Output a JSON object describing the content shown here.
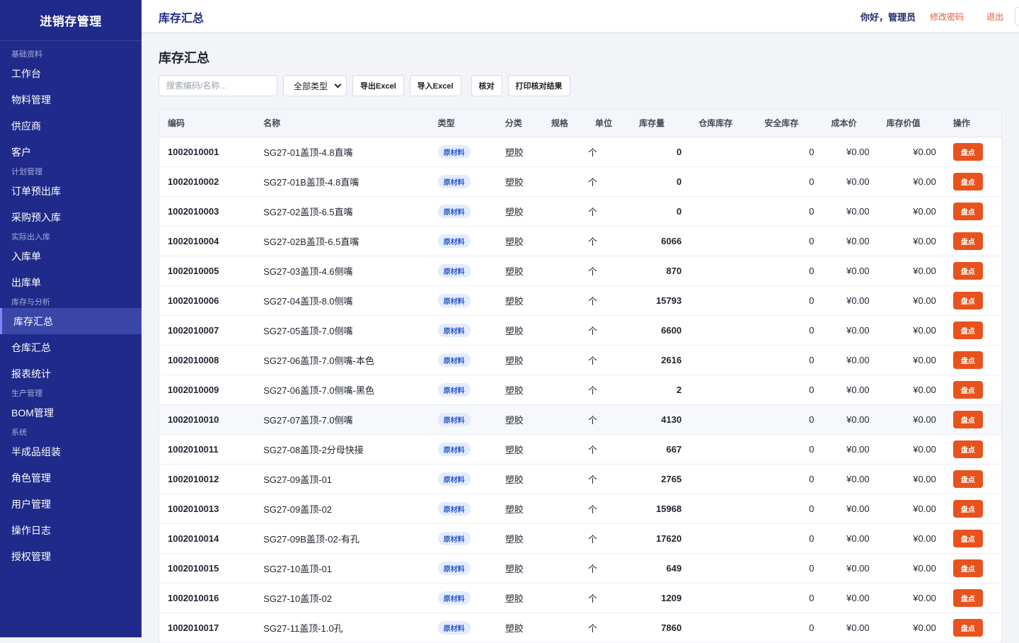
{
  "app": {
    "brand": "进销存管理"
  },
  "sidebar": {
    "groups": [
      {
        "title": "基础资料",
        "items": [
          "工作台",
          "物料管理",
          "供应商",
          "客户"
        ]
      },
      {
        "title": "计划管理",
        "items": [
          "订单预出库",
          "采购预入库"
        ]
      },
      {
        "title": "实际出入库",
        "items": [
          "入库单",
          "出库单"
        ]
      },
      {
        "title": "库存与分析",
        "items": [
          "库存汇总",
          "仓库汇总",
          "报表统计"
        ]
      },
      {
        "title": "生产管理",
        "items": [
          "BOM管理"
        ]
      },
      {
        "title": "系统",
        "items": [
          "半成品组装",
          "角色管理",
          "用户管理",
          "操作日志",
          "授权管理"
        ]
      }
    ],
    "active_item": "库存汇总"
  },
  "topbar": {
    "title": "库存汇总",
    "greeting": "你好，管理员",
    "change_password": "修改密码",
    "logout": "退出"
  },
  "page": {
    "title": "库存汇总"
  },
  "toolbar": {
    "search_placeholder": "搜索编码/名称...",
    "type_select": "全部类型",
    "export_label": "导出Excel",
    "import_label": "导入Excel",
    "check_label": "核对",
    "print_label": "打印核对结果"
  },
  "table": {
    "columns": [
      "编码",
      "名称",
      "类型",
      "分类",
      "规格",
      "单位",
      "库存量",
      "仓库库存",
      "安全库存",
      "成本价",
      "库存价值",
      "操作"
    ],
    "action_label": "盘点",
    "rows": [
      {
        "code": "1002010001",
        "name": "SG27-01盖顶-4.8直嘴",
        "type": "原材料",
        "category": "塑胶",
        "spec": "",
        "unit": "个",
        "qty": "0",
        "wh": "",
        "safe": "0",
        "cost": "¥0.00",
        "value": "¥0.00"
      },
      {
        "code": "1002010002",
        "name": "SG27-01B盖顶-4.8直嘴",
        "type": "原材料",
        "category": "塑胶",
        "spec": "",
        "unit": "个",
        "qty": "0",
        "wh": "",
        "safe": "0",
        "cost": "¥0.00",
        "value": "¥0.00"
      },
      {
        "code": "1002010003",
        "name": "SG27-02盖顶-6.5直嘴",
        "type": "原材料",
        "category": "塑胶",
        "spec": "",
        "unit": "个",
        "qty": "0",
        "wh": "",
        "safe": "0",
        "cost": "¥0.00",
        "value": "¥0.00"
      },
      {
        "code": "1002010004",
        "name": "SG27-02B盖顶-6.5直嘴",
        "type": "原材料",
        "category": "塑胶",
        "spec": "",
        "unit": "个",
        "qty": "6066",
        "wh": "",
        "safe": "0",
        "cost": "¥0.00",
        "value": "¥0.00"
      },
      {
        "code": "1002010005",
        "name": "SG27-03盖顶-4.6侧嘴",
        "type": "原材料",
        "category": "塑胶",
        "spec": "",
        "unit": "个",
        "qty": "870",
        "wh": "",
        "safe": "0",
        "cost": "¥0.00",
        "value": "¥0.00"
      },
      {
        "code": "1002010006",
        "name": "SG27-04盖顶-8.0侧嘴",
        "type": "原材料",
        "category": "塑胶",
        "spec": "",
        "unit": "个",
        "qty": "15793",
        "wh": "",
        "safe": "0",
        "cost": "¥0.00",
        "value": "¥0.00"
      },
      {
        "code": "1002010007",
        "name": "SG27-05盖顶-7.0侧嘴",
        "type": "原材料",
        "category": "塑胶",
        "spec": "",
        "unit": "个",
        "qty": "6600",
        "wh": "",
        "safe": "0",
        "cost": "¥0.00",
        "value": "¥0.00"
      },
      {
        "code": "1002010008",
        "name": "SG27-06盖顶-7.0侧嘴-本色",
        "type": "原材料",
        "category": "塑胶",
        "spec": "",
        "unit": "个",
        "qty": "2616",
        "wh": "",
        "safe": "0",
        "cost": "¥0.00",
        "value": "¥0.00"
      },
      {
        "code": "1002010009",
        "name": "SG27-06盖顶-7.0侧嘴-黑色",
        "type": "原材料",
        "category": "塑胶",
        "spec": "",
        "unit": "个",
        "qty": "2",
        "wh": "",
        "safe": "0",
        "cost": "¥0.00",
        "value": "¥0.00"
      },
      {
        "code": "1002010010",
        "name": "SG27-07盖顶-7.0侧嘴",
        "type": "原材料",
        "category": "塑胶",
        "spec": "",
        "unit": "个",
        "qty": "4130",
        "wh": "",
        "safe": "0",
        "cost": "¥0.00",
        "value": "¥0.00"
      },
      {
        "code": "1002010011",
        "name": "SG27-08盖顶-2分母快接",
        "type": "原材料",
        "category": "塑胶",
        "spec": "",
        "unit": "个",
        "qty": "667",
        "wh": "",
        "safe": "0",
        "cost": "¥0.00",
        "value": "¥0.00"
      },
      {
        "code": "1002010012",
        "name": "SG27-09盖顶-01",
        "type": "原材料",
        "category": "塑胶",
        "spec": "",
        "unit": "个",
        "qty": "2765",
        "wh": "",
        "safe": "0",
        "cost": "¥0.00",
        "value": "¥0.00"
      },
      {
        "code": "1002010013",
        "name": "SG27-09盖顶-02",
        "type": "原材料",
        "category": "塑胶",
        "spec": "",
        "unit": "个",
        "qty": "15968",
        "wh": "",
        "safe": "0",
        "cost": "¥0.00",
        "value": "¥0.00"
      },
      {
        "code": "1002010014",
        "name": "SG27-09B盖顶-02-有孔",
        "type": "原材料",
        "category": "塑胶",
        "spec": "",
        "unit": "个",
        "qty": "17620",
        "wh": "",
        "safe": "0",
        "cost": "¥0.00",
        "value": "¥0.00"
      },
      {
        "code": "1002010015",
        "name": "SG27-10盖顶-01",
        "type": "原材料",
        "category": "塑胶",
        "spec": "",
        "unit": "个",
        "qty": "649",
        "wh": "",
        "safe": "0",
        "cost": "¥0.00",
        "value": "¥0.00"
      },
      {
        "code": "1002010016",
        "name": "SG27-10盖顶-02",
        "type": "原材料",
        "category": "塑胶",
        "spec": "",
        "unit": "个",
        "qty": "1209",
        "wh": "",
        "safe": "0",
        "cost": "¥0.00",
        "value": "¥0.00"
      },
      {
        "code": "1002010017",
        "name": "SG27-11盖顶-1.0孔",
        "type": "原材料",
        "category": "塑胶",
        "spec": "",
        "unit": "个",
        "qty": "7860",
        "wh": "",
        "safe": "0",
        "cost": "¥0.00",
        "value": "¥0.00"
      }
    ]
  }
}
